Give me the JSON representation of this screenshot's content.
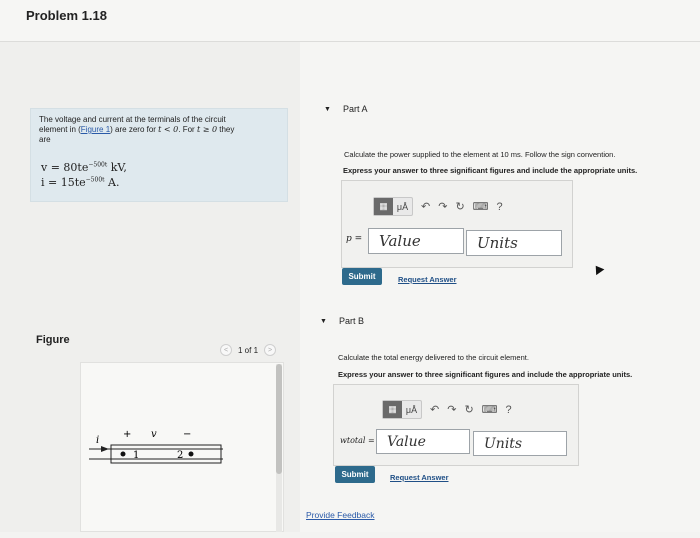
{
  "header": {
    "title": "Problem 1.18"
  },
  "problem": {
    "text_1": "The voltage and current at the terminals of the circuit",
    "text_2a": "element in (",
    "figure_link": "Figure 1",
    "text_2b": ") are zero for ",
    "cond_1": "t < 0",
    "text_2c": ". For ",
    "cond_2": "t ≥ 0",
    "text_2d": " they",
    "text_3": "are",
    "eq_v_lhs": "v = 80te",
    "eq_v_exp": "−500t",
    "eq_v_unit": " kV,",
    "eq_i_lhs": "i = 15te",
    "eq_i_exp": "−500t",
    "eq_i_unit": " A."
  },
  "figure": {
    "label": "Figure",
    "pager": "1 of 1",
    "prev": "<",
    "next": ">",
    "i_label": "i",
    "plus": "+",
    "v_label": "v",
    "minus": "−",
    "node1": "1",
    "node2": "2"
  },
  "part_a": {
    "caret": "▼",
    "title": "Part A",
    "question": "Calculate the power supplied to the element at 10 ms. Follow the sign convention.",
    "instruction": "Express your answer to three significant figures and include the appropriate units.",
    "var_label": "p =",
    "value_placeholder": "Value",
    "units_placeholder": "Units",
    "submit": "Submit",
    "request": "Request Answer"
  },
  "part_b": {
    "caret": "▼",
    "title": "Part B",
    "question": "Calculate the total energy delivered to the circuit element.",
    "instruction": "Express your answer to three significant figures and include the appropriate units.",
    "var_label": "wtotal =",
    "value_placeholder": "Value",
    "units_placeholder": "Units",
    "submit": "Submit",
    "request": "Request Answer"
  },
  "toolbar": {
    "mu": "μÅ",
    "help": "?"
  },
  "footer": {
    "feedback": "Provide Feedback"
  }
}
